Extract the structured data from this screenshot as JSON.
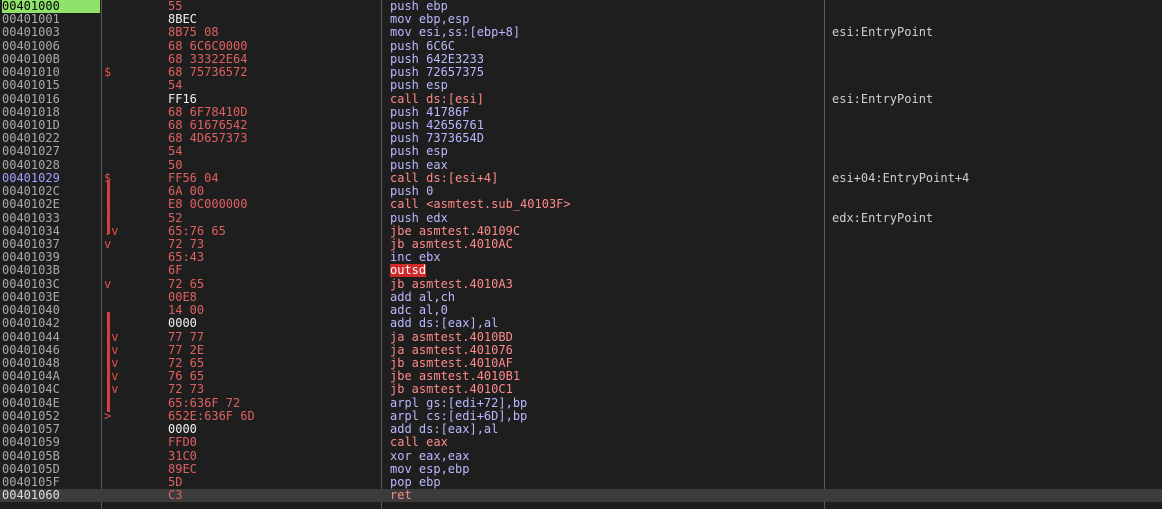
{
  "rows": [
    {
      "addr": "00401000",
      "gutter": "",
      "bytes": "55",
      "instr": "push ebp",
      "comment": "",
      "style": "green"
    },
    {
      "addr": "00401001",
      "gutter": "",
      "bytes": "8BEC",
      "instr": "mov ebp,esp",
      "comment": "",
      "bytes_style": "white"
    },
    {
      "addr": "00401003",
      "gutter": "",
      "bytes": "8B75 08",
      "instr": "mov esi,ss:[ebp+8]",
      "comment": "esi:EntryPoint"
    },
    {
      "addr": "00401006",
      "gutter": "",
      "bytes": "68 6C6C0000",
      "instr": "push 6C6C",
      "comment": ""
    },
    {
      "addr": "0040100B",
      "gutter": "",
      "bytes": "68 33322E64",
      "instr": "push 642E3233",
      "comment": ""
    },
    {
      "addr": "00401010",
      "gutter": "$",
      "bytes": "68 75736572",
      "instr": "push 72657375",
      "comment": ""
    },
    {
      "addr": "00401015",
      "gutter": "",
      "bytes": "54",
      "instr": "push esp",
      "comment": ""
    },
    {
      "addr": "00401016",
      "gutter": "",
      "bytes": "FF16",
      "instr": "call ds:[esi]",
      "comment": "esi:EntryPoint",
      "bytes_style": "white",
      "instr_style": "red"
    },
    {
      "addr": "00401018",
      "gutter": "",
      "bytes": "68 6F78410D",
      "instr": "push 41786F",
      "comment": ""
    },
    {
      "addr": "0040101D",
      "gutter": "",
      "bytes": "68 61676542",
      "instr": "push 42656761",
      "comment": ""
    },
    {
      "addr": "00401022",
      "gutter": "",
      "bytes": "68 4D657373",
      "instr": "push 7373654D",
      "comment": ""
    },
    {
      "addr": "00401027",
      "gutter": "",
      "bytes": "54",
      "instr": "push esp",
      "comment": ""
    },
    {
      "addr": "00401028",
      "gutter": "",
      "bytes": "50",
      "instr": "push eax",
      "comment": ""
    },
    {
      "addr": "00401029",
      "gutter": "$",
      "bytes": "FF56 04",
      "instr": "call ds:[esi+4]",
      "comment": "esi+04:EntryPoint+4",
      "style": "blue",
      "instr_style": "red"
    },
    {
      "addr": "0040102C",
      "gutter": ".",
      "bytes": "6A 00",
      "instr": "push 0",
      "comment": ""
    },
    {
      "addr": "0040102E",
      "gutter": ".",
      "bytes": "E8 0C000000",
      "instr": "call <asmtest.sub_40103F>",
      "comment": "",
      "instr_style": "red"
    },
    {
      "addr": "00401033",
      "gutter": ".",
      "bytes": "52",
      "instr": "push edx",
      "comment": "edx:EntryPoint"
    },
    {
      "addr": "00401034",
      "gutter": ".v",
      "bytes": "65:76 65",
      "instr": "jbe asmtest.40109C",
      "comment": "",
      "instr_style": "red"
    },
    {
      "addr": "00401037",
      "gutter": "v",
      "bytes": "72 73",
      "instr": "jb asmtest.4010AC",
      "comment": "",
      "instr_style": "red"
    },
    {
      "addr": "00401039",
      "gutter": "",
      "bytes": "65:43",
      "instr": "inc ebx",
      "comment": ""
    },
    {
      "addr": "0040103B",
      "gutter": "",
      "bytes": "6F",
      "instr": "outsd",
      "comment": "",
      "instr_style": "hlred"
    },
    {
      "addr": "0040103C",
      "gutter": "v",
      "bytes": "72 65",
      "instr": "jb asmtest.4010A3",
      "comment": "",
      "instr_style": "red"
    },
    {
      "addr": "0040103E",
      "gutter": "",
      "bytes": "00E8",
      "instr": "add al,ch",
      "comment": ""
    },
    {
      "addr": "00401040",
      "gutter": ".",
      "bytes": "14 00",
      "instr": "adc al,0",
      "comment": ""
    },
    {
      "addr": "00401042",
      "gutter": ".",
      "bytes": "0000",
      "instr": "add ds:[eax],al",
      "comment": "",
      "bytes_style": "white"
    },
    {
      "addr": "00401044",
      "gutter": ".v",
      "bytes": "77 77",
      "instr": "ja asmtest.4010BD",
      "comment": "",
      "instr_style": "red"
    },
    {
      "addr": "00401046",
      "gutter": ".v",
      "bytes": "77 2E",
      "instr": "ja asmtest.401076",
      "comment": "",
      "instr_style": "red"
    },
    {
      "addr": "00401048",
      "gutter": ".v",
      "bytes": "72 65",
      "instr": "jb asmtest.4010AF",
      "comment": "",
      "instr_style": "red"
    },
    {
      "addr": "0040104A",
      "gutter": ".v",
      "bytes": "76 65",
      "instr": "jbe asmtest.4010B1",
      "comment": "",
      "instr_style": "red"
    },
    {
      "addr": "0040104C",
      "gutter": ".v",
      "bytes": "72 73",
      "instr": "jb asmtest.4010C1",
      "comment": "",
      "instr_style": "red"
    },
    {
      "addr": "0040104E",
      "gutter": ".",
      "bytes": "65:636F 72",
      "instr": "arpl gs:[edi+72],bp",
      "comment": ""
    },
    {
      "addr": "00401052",
      "gutter": ">",
      "bytes": "652E:636F 6D",
      "instr": "arpl cs:[edi+6D],bp",
      "comment": ""
    },
    {
      "addr": "00401057",
      "gutter": "",
      "bytes": "0000",
      "instr": "add ds:[eax],al",
      "comment": "",
      "bytes_style": "white"
    },
    {
      "addr": "00401059",
      "gutter": "",
      "bytes": "FFD0",
      "instr": "call eax",
      "comment": "",
      "instr_style": "red"
    },
    {
      "addr": "0040105B",
      "gutter": "",
      "bytes": "31C0",
      "instr": "xor eax,eax",
      "comment": ""
    },
    {
      "addr": "0040105D",
      "gutter": "",
      "bytes": "89EC",
      "instr": "mov esp,ebp",
      "comment": ""
    },
    {
      "addr": "0040105F",
      "gutter": "",
      "bytes": "5D",
      "instr": "pop ebp",
      "comment": ""
    },
    {
      "addr": "00401060",
      "gutter": "",
      "bytes": "C3",
      "instr": "ret",
      "comment": "",
      "style": "last",
      "instr_style": "red"
    }
  ],
  "colors": {
    "background": "#1e1e1e",
    "address": "#a9a9a9",
    "bytes": "#e06060",
    "instruction": "#b9b9ff",
    "call_jump": "#ff8a8a",
    "highlight_green": "#8fe36a",
    "highlight_red": "#d02a2a",
    "comment": "#cfcfcf"
  }
}
